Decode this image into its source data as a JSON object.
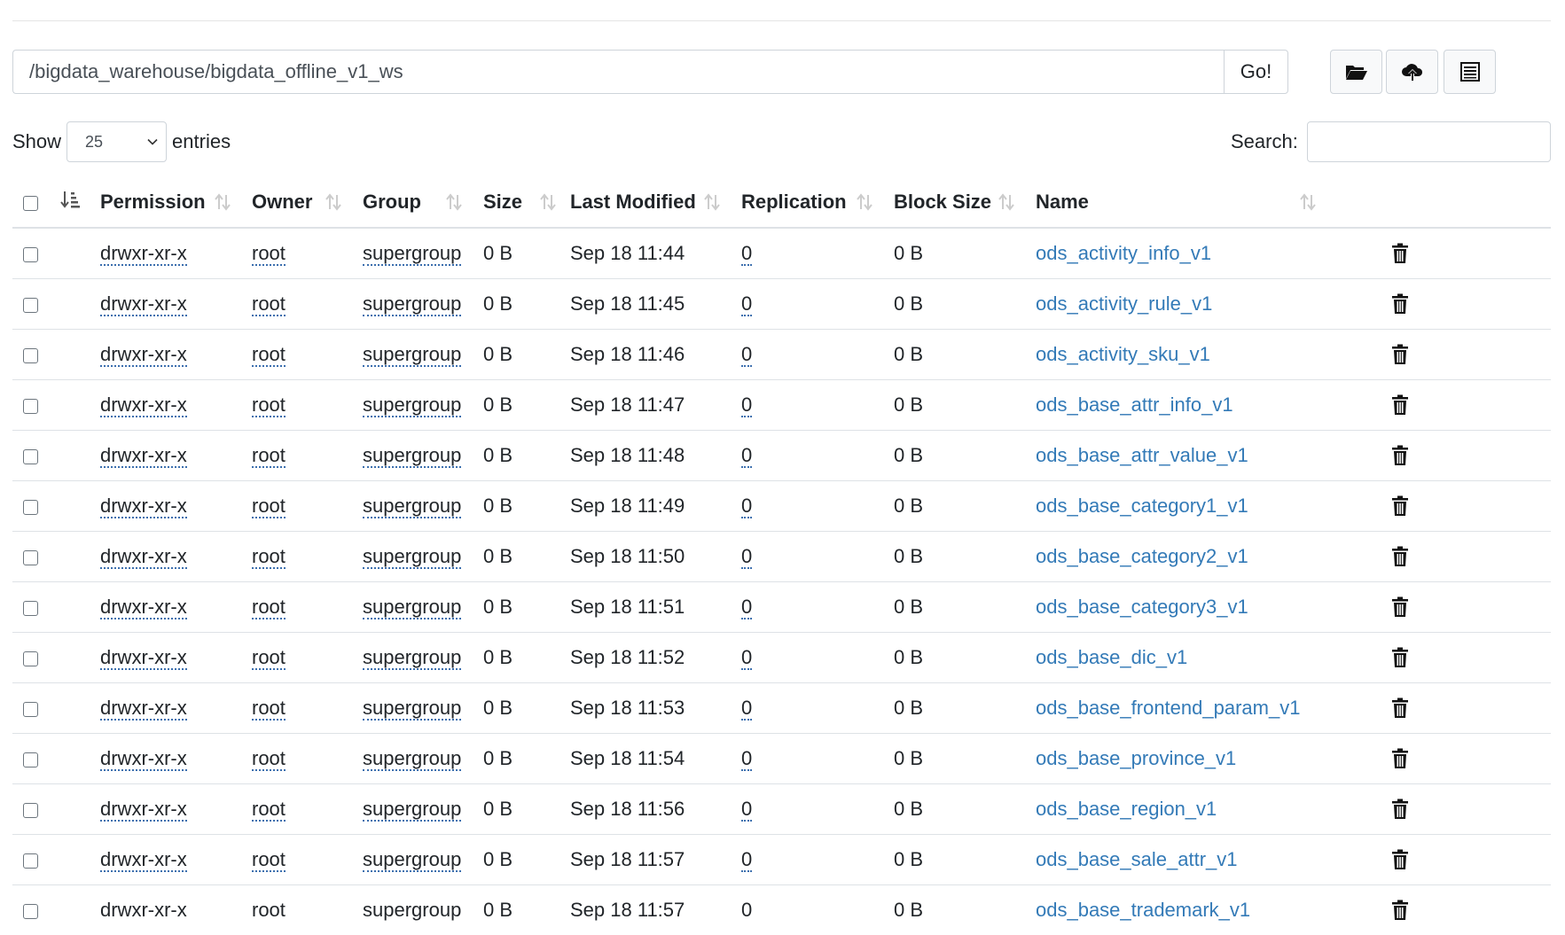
{
  "toolbar": {
    "path_value": "/bigdata_warehouse/bigdata_offline_v1_ws",
    "go_label": "Go!",
    "buttons": [
      {
        "icon": "folder-open-icon"
      },
      {
        "icon": "cloud-upload-icon"
      },
      {
        "icon": "list-icon"
      }
    ]
  },
  "length": {
    "show_label": "Show",
    "selected": "25",
    "entries_label": "entries"
  },
  "search": {
    "label": "Search:",
    "value": ""
  },
  "table": {
    "columns": [
      "Permission",
      "Owner",
      "Group",
      "Size",
      "Last Modified",
      "Replication",
      "Block Size",
      "Name"
    ],
    "rows": [
      {
        "permission": "drwxr-xr-x",
        "owner": "root",
        "group": "supergroup",
        "size": "0 B",
        "modified": "Sep 18 11:44",
        "replication": "0",
        "block_size": "0 B",
        "name": "ods_activity_info_v1"
      },
      {
        "permission": "drwxr-xr-x",
        "owner": "root",
        "group": "supergroup",
        "size": "0 B",
        "modified": "Sep 18 11:45",
        "replication": "0",
        "block_size": "0 B",
        "name": "ods_activity_rule_v1"
      },
      {
        "permission": "drwxr-xr-x",
        "owner": "root",
        "group": "supergroup",
        "size": "0 B",
        "modified": "Sep 18 11:46",
        "replication": "0",
        "block_size": "0 B",
        "name": "ods_activity_sku_v1"
      },
      {
        "permission": "drwxr-xr-x",
        "owner": "root",
        "group": "supergroup",
        "size": "0 B",
        "modified": "Sep 18 11:47",
        "replication": "0",
        "block_size": "0 B",
        "name": "ods_base_attr_info_v1"
      },
      {
        "permission": "drwxr-xr-x",
        "owner": "root",
        "group": "supergroup",
        "size": "0 B",
        "modified": "Sep 18 11:48",
        "replication": "0",
        "block_size": "0 B",
        "name": "ods_base_attr_value_v1"
      },
      {
        "permission": "drwxr-xr-x",
        "owner": "root",
        "group": "supergroup",
        "size": "0 B",
        "modified": "Sep 18 11:49",
        "replication": "0",
        "block_size": "0 B",
        "name": "ods_base_category1_v1"
      },
      {
        "permission": "drwxr-xr-x",
        "owner": "root",
        "group": "supergroup",
        "size": "0 B",
        "modified": "Sep 18 11:50",
        "replication": "0",
        "block_size": "0 B",
        "name": "ods_base_category2_v1"
      },
      {
        "permission": "drwxr-xr-x",
        "owner": "root",
        "group": "supergroup",
        "size": "0 B",
        "modified": "Sep 18 11:51",
        "replication": "0",
        "block_size": "0 B",
        "name": "ods_base_category3_v1"
      },
      {
        "permission": "drwxr-xr-x",
        "owner": "root",
        "group": "supergroup",
        "size": "0 B",
        "modified": "Sep 18 11:52",
        "replication": "0",
        "block_size": "0 B",
        "name": "ods_base_dic_v1"
      },
      {
        "permission": "drwxr-xr-x",
        "owner": "root",
        "group": "supergroup",
        "size": "0 B",
        "modified": "Sep 18 11:53",
        "replication": "0",
        "block_size": "0 B",
        "name": "ods_base_frontend_param_v1"
      },
      {
        "permission": "drwxr-xr-x",
        "owner": "root",
        "group": "supergroup",
        "size": "0 B",
        "modified": "Sep 18 11:54",
        "replication": "0",
        "block_size": "0 B",
        "name": "ods_base_province_v1"
      },
      {
        "permission": "drwxr-xr-x",
        "owner": "root",
        "group": "supergroup",
        "size": "0 B",
        "modified": "Sep 18 11:56",
        "replication": "0",
        "block_size": "0 B",
        "name": "ods_base_region_v1"
      },
      {
        "permission": "drwxr-xr-x",
        "owner": "root",
        "group": "supergroup",
        "size": "0 B",
        "modified": "Sep 18 11:57",
        "replication": "0",
        "block_size": "0 B",
        "name": "ods_base_sale_attr_v1"
      },
      {
        "permission": "drwxr-xr-x",
        "owner": "root",
        "group": "supergroup",
        "size": "0 B",
        "modified": "Sep 18 11:57",
        "replication": "0",
        "block_size": "0 B",
        "name": "ods_base_trademark_v1"
      }
    ]
  },
  "colors": {
    "link": "#337ab7",
    "border": "#dee2e6"
  }
}
